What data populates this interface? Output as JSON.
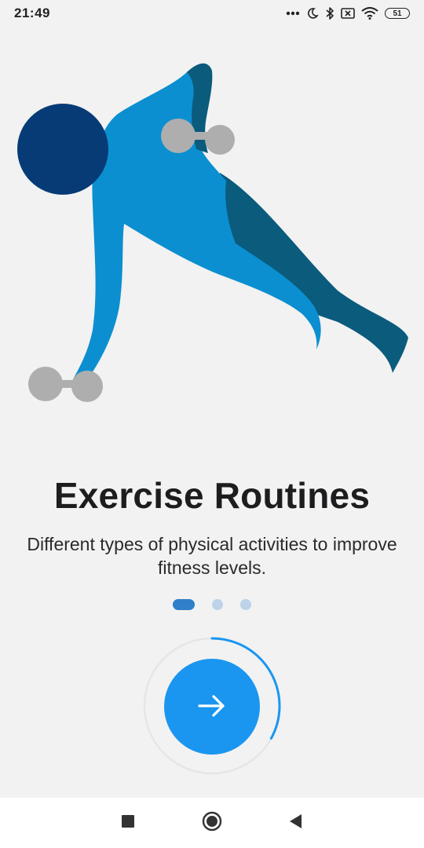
{
  "status_bar": {
    "time": "21:49",
    "battery_level": "51",
    "icons": [
      "more-dots-icon",
      "moon-icon",
      "bluetooth-icon",
      "sim-off-icon",
      "wifi-icon",
      "battery-icon"
    ]
  },
  "illustration": {
    "name": "exercise-figure-illustration",
    "colors": {
      "head": "#073b76",
      "body": "#0b8fd0",
      "body_shade": "#0a5b7c",
      "dumbbell": "#aeaeae"
    }
  },
  "onboarding": {
    "title": "Exercise Routines",
    "subtitle": "Different types of physical activities to improve fitness levels.",
    "page_index": 0,
    "page_count": 3,
    "progress": 0.33
  },
  "next_button": {
    "icon": "arrow-right-icon",
    "color": "#1a96f0"
  },
  "nav_bar": {
    "buttons": [
      "recents-square-icon",
      "home-circle-icon",
      "back-triangle-icon"
    ]
  },
  "colors": {
    "background": "#f2f2f2",
    "accent": "#1a96f0",
    "dot_active": "#2f7fc9",
    "dot_inactive": "#bcd3ea"
  }
}
